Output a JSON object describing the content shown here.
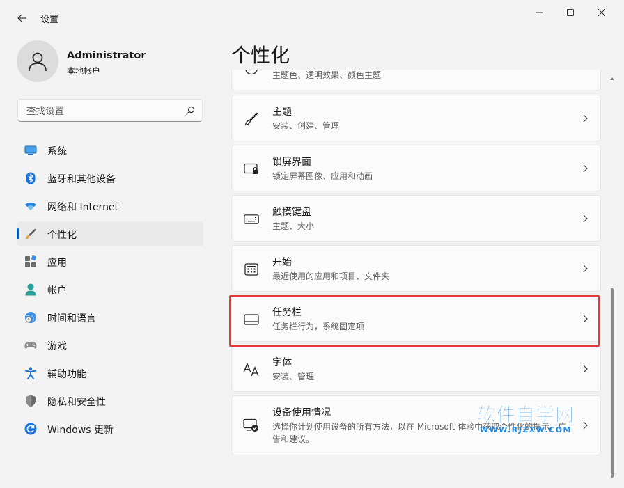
{
  "window": {
    "title": "设置"
  },
  "user": {
    "name": "Administrator",
    "account_type": "本地帐户"
  },
  "search": {
    "placeholder": "查找设置"
  },
  "sidebar": {
    "items": [
      {
        "label": "系统",
        "icon": "display-icon"
      },
      {
        "label": "蓝牙和其他设备",
        "icon": "bluetooth-icon"
      },
      {
        "label": "网络和 Internet",
        "icon": "wifi-icon"
      },
      {
        "label": "个性化",
        "icon": "brush-icon",
        "active": true
      },
      {
        "label": "应用",
        "icon": "apps-icon"
      },
      {
        "label": "帐户",
        "icon": "person-icon"
      },
      {
        "label": "时间和语言",
        "icon": "globe-clock-icon"
      },
      {
        "label": "游戏",
        "icon": "gamepad-icon"
      },
      {
        "label": "辅助功能",
        "icon": "accessibility-icon"
      },
      {
        "label": "隐私和安全性",
        "icon": "shield-icon"
      },
      {
        "label": "Windows 更新",
        "icon": "update-icon"
      }
    ]
  },
  "main": {
    "title": "个性化",
    "cards": [
      {
        "title": "",
        "subtitle": "主题色、透明效果、颜色主题",
        "icon": "palette-icon"
      },
      {
        "title": "主题",
        "subtitle": "安装、创建、管理",
        "icon": "brush-icon"
      },
      {
        "title": "锁屏界面",
        "subtitle": "锁定屏幕图像、应用和动画",
        "icon": "lock-screen-icon"
      },
      {
        "title": "触摸键盘",
        "subtitle": "主题、大小",
        "icon": "keyboard-icon"
      },
      {
        "title": "开始",
        "subtitle": "最近使用的应用和项目、文件夹",
        "icon": "start-menu-icon"
      },
      {
        "title": "任务栏",
        "subtitle": "任务栏行为，系统固定项",
        "icon": "taskbar-icon",
        "highlighted": true
      },
      {
        "title": "字体",
        "subtitle": "安装、管理",
        "icon": "fonts-icon"
      },
      {
        "title": "设备使用情况",
        "subtitle": "选择你计划使用设备的所有方法，以在 Microsoft 体验中获取个性化的提示、广告和建议。",
        "icon": "device-usage-icon"
      }
    ]
  },
  "watermark": {
    "text": "软件自学网",
    "url": "WWW.RJZXW.COM"
  },
  "colors": {
    "accent": "#005fb8",
    "highlight_border": "#e03a3a",
    "watermark": "#1e88e5"
  }
}
